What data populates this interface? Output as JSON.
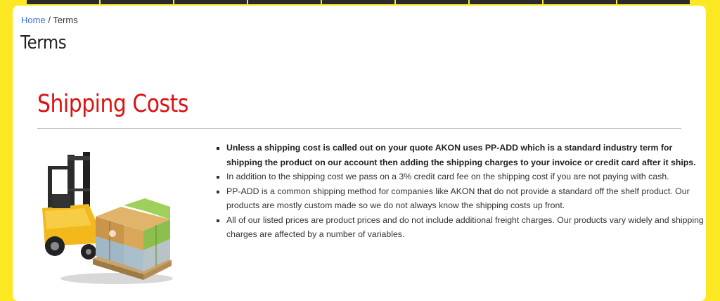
{
  "breadcrumb": {
    "home": "Home",
    "separator": "/",
    "current": "Terms"
  },
  "page": {
    "title": "Terms"
  },
  "section": {
    "title": "Shipping Costs"
  },
  "illustration": {
    "icon": "forklift-with-boxes-icon"
  },
  "terms": [
    "Unless a shipping cost is called out on your quote AKON uses PP-ADD which is a standard industry term for shipping the product on our account then adding the shipping charges to your invoice or credit card after it ships.",
    "In addition to the shipping cost we pass on a 3% credit card fee on the shipping cost if you are not paying with cash.",
    "PP-ADD is a common shipping method for companies like AKON that do not provide a standard off the shelf product. Our products are mostly custom made so we do not always know the shipping costs up front.",
    "All of our listed prices are product prices and do not include additional freight charges. Our products vary widely and shipping charges are affected by a number of variables."
  ],
  "colors": {
    "background": "#fce723",
    "accent_heading": "#dd1111",
    "link": "#3a6fd8",
    "nav": "#2a2a2a"
  }
}
